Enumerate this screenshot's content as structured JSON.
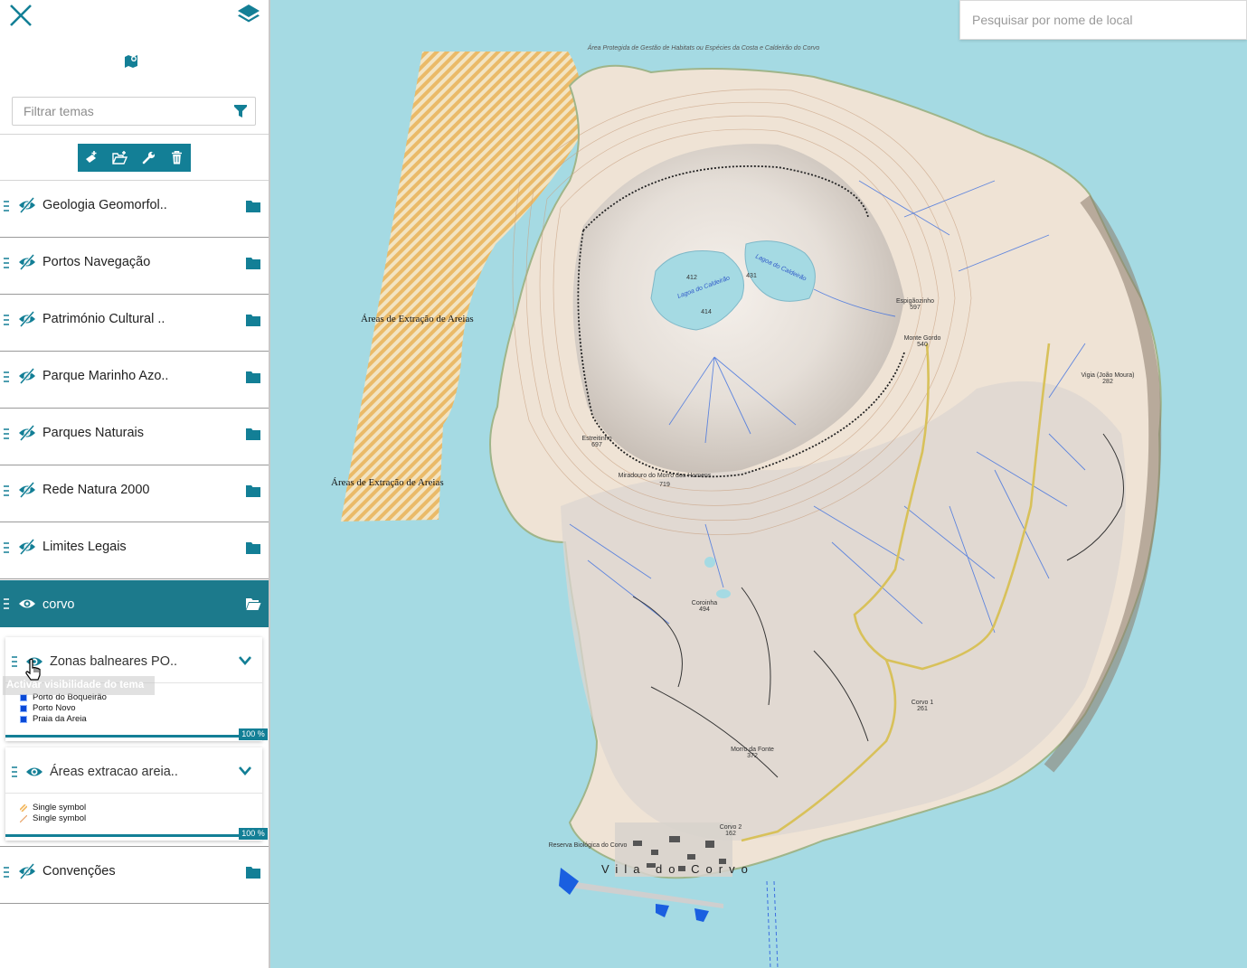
{
  "sidebar": {
    "filter_placeholder": "Filtrar temas",
    "toolbar": {
      "add_layer": "add-layer",
      "add_folder": "add-folder",
      "settings": "wrench",
      "delete": "trash"
    },
    "themes": [
      {
        "label": "Geologia Geomorfol..",
        "visible": false
      },
      {
        "label": "Portos Navegação",
        "visible": false
      },
      {
        "label": "Património Cultural ..",
        "visible": false
      },
      {
        "label": "Parque Marinho Azo..",
        "visible": false
      },
      {
        "label": "Parques Naturais",
        "visible": false
      },
      {
        "label": "Rede Natura 2000",
        "visible": false
      },
      {
        "label": "Limites Legais",
        "visible": false
      },
      {
        "label": "corvo",
        "visible": true,
        "expanded": true
      },
      {
        "label": "Convenções",
        "visible": false
      }
    ],
    "sublayers": [
      {
        "label": "Zonas balneares PO..",
        "legend": [
          "Porto do Boqueirão",
          "Porto Novo",
          "Praia da Areia"
        ],
        "opacity": "100 %"
      },
      {
        "label": "Áreas extracao areia..",
        "legend": [
          "Single symbol",
          "Single symbol"
        ],
        "opacity": "100 %"
      }
    ],
    "tooltip": "Activar visibilidade do tema"
  },
  "map": {
    "search_placeholder": "Pesquisar por nome de local",
    "labels": {
      "areia1": "Áreas de Extração de Areias",
      "areia2": "Áreas de Extração de Areias",
      "vila": "Vila do Corvo",
      "espigaozinho": "Espigãozinho",
      "espigaozinho_alt": "597",
      "monte_gordo": "Monte Gordo",
      "monte_gordo_alt": "540",
      "estreitinho": "Estreitinho",
      "estreitinho_alt": "697",
      "miradouro": "Miradouro do Morro dos Homens",
      "miradouro_alt": "719",
      "coroinha": "Coroinha",
      "coroinha_alt": "494",
      "morro_fonte": "Morro da Fonte",
      "morro_fonte_alt": "372",
      "corvo1": "Corvo 1",
      "corvo1_alt": "261",
      "corvo2": "Corvo 2",
      "corvo2_alt": "162",
      "vigia": "Vigia (João Moura)",
      "vigia_alt": "282",
      "lagoa1": "Lagoa do Caldeirão",
      "lagoa2": "Lagoa do Caldeirão",
      "alt431": "431",
      "alt414": "414",
      "alt412": "412",
      "area_protegida_n": "Área Protegida de Gestão de Habitats ou Espécies da Costa e Caldeirão do Corvo",
      "reserva": "Reserva Biológica do Corvo"
    }
  },
  "colors": {
    "accent": "#137f96",
    "active_row": "#1c7a8c",
    "sea": "#a5dae3",
    "land": "#efe3d5",
    "sand_hatch": "#f2b65a"
  }
}
